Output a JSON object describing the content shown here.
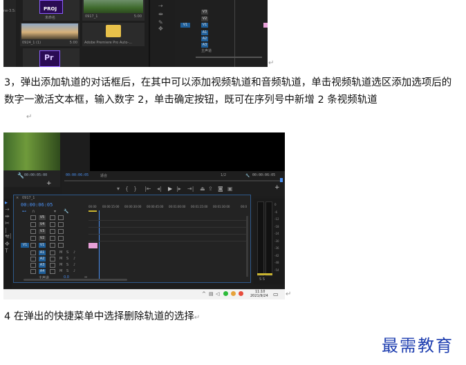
{
  "screenshot1": {
    "left_label": "ne-3.5:",
    "thumbnails": [
      {
        "badge": "PROJ",
        "name": "未命名",
        "type": "proj"
      },
      {
        "name": "0917_1",
        "duration": "5:00",
        "type": "video-green"
      },
      {
        "name": "0924_1 (1)",
        "duration": "5:00",
        "type": "video-sunset"
      },
      {
        "name": "Adobe Premiere Pro Auto-...",
        "type": "folder"
      },
      {
        "badge": "Pr",
        "type": "pr"
      }
    ],
    "tracks": {
      "v": [
        "V3",
        "V2",
        "V1"
      ],
      "a": [
        "A1",
        "A2",
        "A3"
      ],
      "master": "主声道",
      "target_v": "V1"
    }
  },
  "paragraph3": "3，弹出添加轨道的对话框后，在其中可以添加视频轨道和音频轨道，单击视频轨道选区添加选项后的数字一激活文本框，输入数字 2，单击确定按钮，既可在序列号中新增 2 条视频轨道",
  "screenshot2": {
    "source_time": "00:00:05:00",
    "program_left_time": "00:00:06:05",
    "fit_label": "适合",
    "fraction": "1/2",
    "program_right_time": "00:00:06:05",
    "sequence_tab": "0917_1",
    "timeline_time": "00:00:06:05",
    "ruler": [
      "00:00",
      "00:00:15:00",
      "00:00:30:00",
      "00:00:45:00",
      "00:01:00:00",
      "00:01:15:00",
      "00:01:30:00",
      "00:0"
    ],
    "video_tracks": [
      "V5",
      "V4",
      "V3",
      "V2",
      "V1"
    ],
    "audio_tracks": [
      "A1",
      "A2",
      "A3",
      "A4"
    ],
    "target_v": "V1",
    "master_label": "主声道",
    "master_value": "0.0",
    "meter_scale": [
      "0",
      "-6",
      "-12",
      "-18",
      "-24",
      "-30",
      "-36",
      "-42",
      "-48",
      "-54"
    ],
    "meter_footer": "S S",
    "tray_time": "11:10",
    "tray_date": "2021/9/24"
  },
  "paragraph4": "4 在弹出的快捷菜单中选择删除轨道的选择",
  "watermark": "最需教育",
  "colors": {
    "accent_blue": "#1f5f9a",
    "playhead": "#4a8ff0",
    "clip_pink": "#e8a0d8",
    "watermark": "#1f3fb0"
  }
}
